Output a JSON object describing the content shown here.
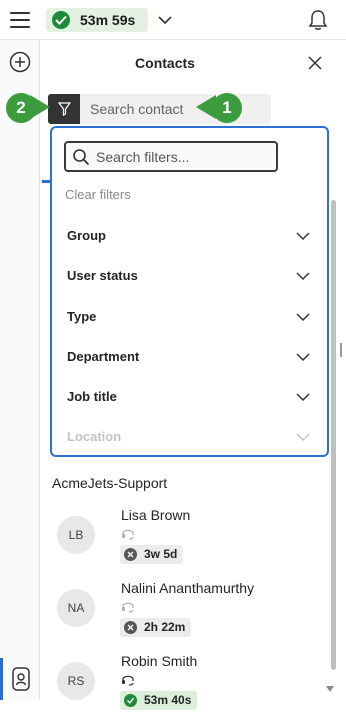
{
  "topbar": {
    "timer": "53m 59s"
  },
  "panel": {
    "title": "Contacts"
  },
  "search": {
    "placeholder": "Search contact"
  },
  "callouts": {
    "one": "1",
    "two": "2"
  },
  "filters": {
    "search_placeholder": "Search filters...",
    "clear_label": "Clear filters",
    "items": [
      {
        "label": "Group"
      },
      {
        "label": "User status"
      },
      {
        "label": "Type"
      },
      {
        "label": "Department"
      },
      {
        "label": "Job title"
      },
      {
        "label": "Location"
      }
    ]
  },
  "contacts": {
    "group_name": "AcmeJets-Support",
    "list": [
      {
        "initials": "LB",
        "name": "Lisa Brown",
        "status": "3w 5d",
        "status_color": "#555555"
      },
      {
        "initials": "NA",
        "name": "Nalini Ananthamurthy",
        "status": "2h 22m",
        "status_color": "#555555"
      },
      {
        "initials": "RS",
        "name": "Robin Smith",
        "status": "53m 40s",
        "status_color": "#1e8a3a"
      }
    ]
  },
  "colors": {
    "accent": "#2f6fd4",
    "callout": "#3b9b3d",
    "available": "#1e8a3a"
  }
}
